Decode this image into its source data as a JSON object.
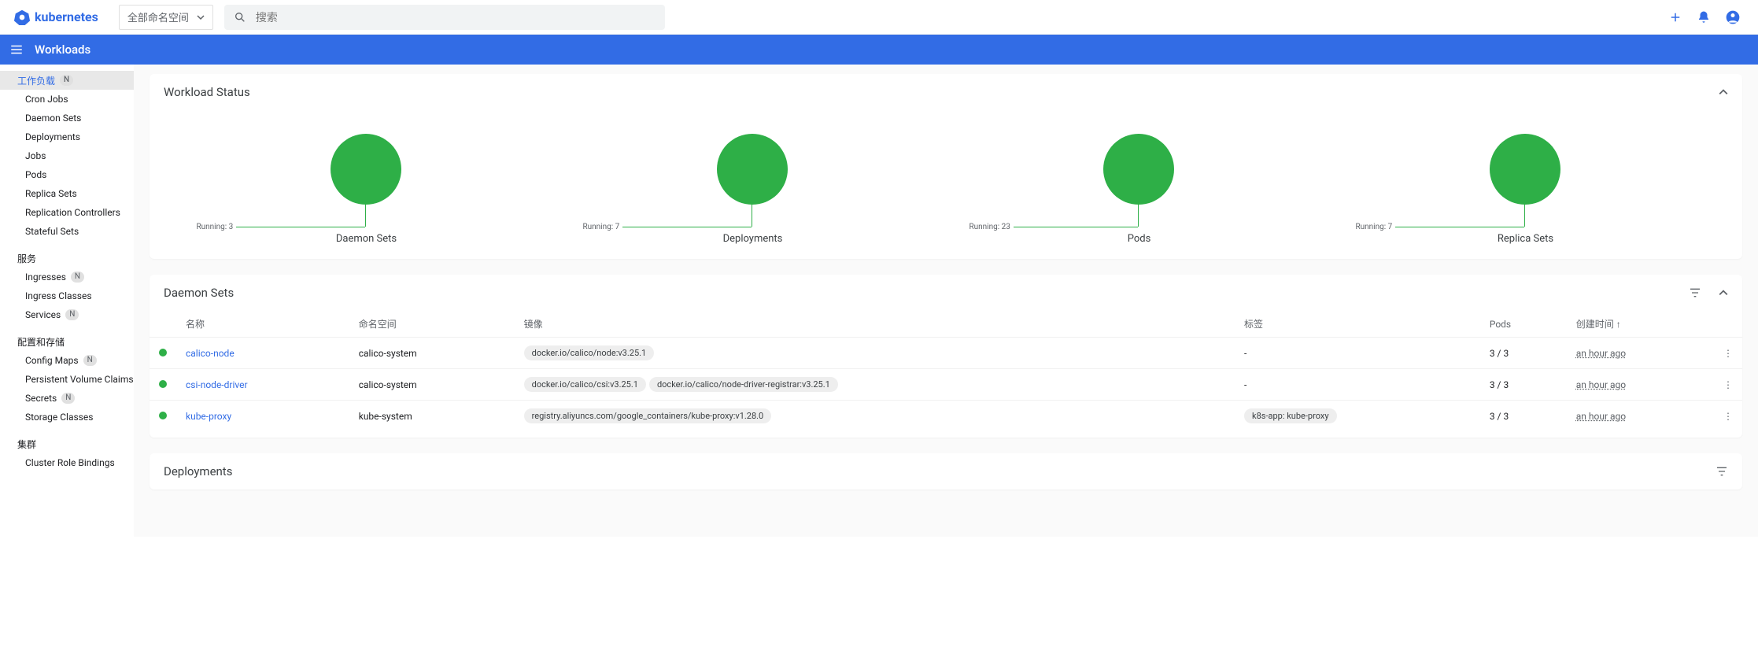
{
  "header": {
    "logo_text": "kubernetes",
    "namespace_selector": "全部命名空间",
    "search_placeholder": "搜索",
    "page_title": "Workloads"
  },
  "sidebar": {
    "groups": [
      {
        "label": "工作负载",
        "badge": "N",
        "active": true,
        "items": [
          {
            "label": "Cron Jobs"
          },
          {
            "label": "Daemon Sets"
          },
          {
            "label": "Deployments"
          },
          {
            "label": "Jobs"
          },
          {
            "label": "Pods"
          },
          {
            "label": "Replica Sets"
          },
          {
            "label": "Replication Controllers"
          },
          {
            "label": "Stateful Sets"
          }
        ]
      },
      {
        "label": "服务",
        "items": [
          {
            "label": "Ingresses",
            "badge": "N"
          },
          {
            "label": "Ingress Classes"
          },
          {
            "label": "Services",
            "badge": "N"
          }
        ]
      },
      {
        "label": "配置和存储",
        "items": [
          {
            "label": "Config Maps",
            "badge": "N"
          },
          {
            "label": "Persistent Volume Claims",
            "badge": "N"
          },
          {
            "label": "Secrets",
            "badge": "N"
          },
          {
            "label": "Storage Classes"
          }
        ]
      },
      {
        "label": "集群",
        "items": [
          {
            "label": "Cluster Role Bindings"
          }
        ]
      }
    ]
  },
  "status_card": {
    "title": "Workload Status",
    "items": [
      {
        "label": "Daemon Sets",
        "running_label": "Running: 3"
      },
      {
        "label": "Deployments",
        "running_label": "Running: 7"
      },
      {
        "label": "Pods",
        "running_label": "Running: 23"
      },
      {
        "label": "Replica Sets",
        "running_label": "Running: 7"
      }
    ]
  },
  "chart_data": [
    {
      "type": "pie",
      "title": "Daemon Sets",
      "series": [
        {
          "name": "Running",
          "value": 3
        }
      ],
      "total": 3,
      "color": "#2eaf47"
    },
    {
      "type": "pie",
      "title": "Deployments",
      "series": [
        {
          "name": "Running",
          "value": 7
        }
      ],
      "total": 7,
      "color": "#2eaf47"
    },
    {
      "type": "pie",
      "title": "Pods",
      "series": [
        {
          "name": "Running",
          "value": 23
        }
      ],
      "total": 23,
      "color": "#2eaf47"
    },
    {
      "type": "pie",
      "title": "Replica Sets",
      "series": [
        {
          "name": "Running",
          "value": 7
        }
      ],
      "total": 7,
      "color": "#2eaf47"
    }
  ],
  "daemon_sets_card": {
    "title": "Daemon Sets",
    "columns": {
      "name": "名称",
      "namespace": "命名空间",
      "images": "镜像",
      "labels": "标签",
      "pods": "Pods",
      "created": "创建时间 ↑"
    },
    "rows": [
      {
        "name": "calico-node",
        "namespace": "calico-system",
        "images": [
          "docker.io/calico/node:v3.25.1"
        ],
        "labels": "-",
        "pods": "3 / 3",
        "created": "an hour ago"
      },
      {
        "name": "csi-node-driver",
        "namespace": "calico-system",
        "images": [
          "docker.io/calico/csi:v3.25.1",
          "docker.io/calico/node-driver-registrar:v3.25.1"
        ],
        "labels": "-",
        "pods": "3 / 3",
        "created": "an hour ago"
      },
      {
        "name": "kube-proxy",
        "namespace": "kube-system",
        "images": [
          "registry.aliyuncs.com/google_containers/kube-proxy:v1.28.0"
        ],
        "labels": "k8s-app: kube-proxy",
        "pods": "3 / 3",
        "created": "an hour ago"
      }
    ]
  },
  "deployments_card": {
    "title": "Deployments"
  }
}
